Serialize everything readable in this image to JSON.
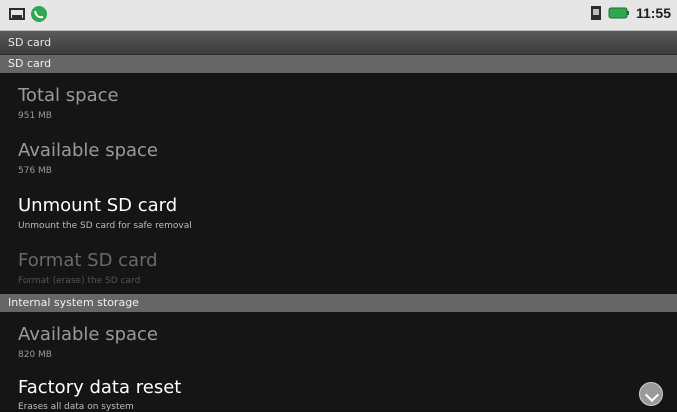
{
  "status_bar": {
    "time": "11:55",
    "left_icons": [
      "notification-picture-icon",
      "call-green-icon"
    ],
    "right_icons": [
      "sim-icon",
      "battery-icon"
    ]
  },
  "title_bar": {
    "title": "SD card"
  },
  "sections": {
    "sd_card": {
      "header": "SD card",
      "items": [
        {
          "title": "Total space",
          "summary": "951 MB"
        },
        {
          "title": "Available space",
          "summary": "576 MB"
        },
        {
          "title": "Unmount SD card",
          "summary": "Unmount the SD card for safe removal"
        },
        {
          "title": "Format SD card",
          "summary": "Format (erase) the SD card"
        }
      ]
    },
    "internal_storage": {
      "header": "Internal system storage",
      "items": [
        {
          "title": "Available space",
          "summary": "820 MB"
        },
        {
          "title": "Factory data reset",
          "summary": "Erases all data on system"
        }
      ]
    }
  }
}
